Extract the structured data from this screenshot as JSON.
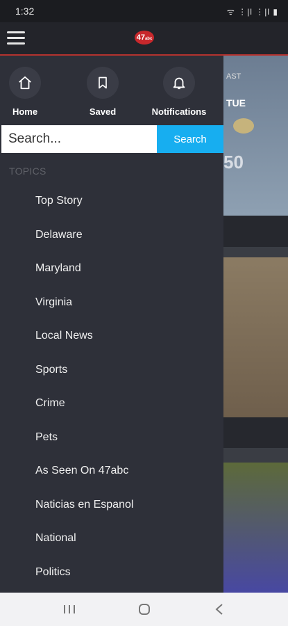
{
  "status_bar": {
    "time": "1:32",
    "icons": "ᯤ ⋮|l ⋮|l ▮"
  },
  "app_bar": {
    "logo_text": "47",
    "logo_sub": "abc"
  },
  "drawer": {
    "quick_actions": [
      {
        "label": "Home",
        "icon": "home-icon"
      },
      {
        "label": "Saved",
        "icon": "bookmark-icon"
      },
      {
        "label": "Notifications",
        "icon": "bell-icon"
      }
    ],
    "search": {
      "placeholder": "Search...",
      "button_label": "Search"
    },
    "topics_heading": "TOPICS",
    "topics": [
      "Top Story",
      "Delaware",
      "Maryland",
      "Virginia",
      "Local News",
      "Sports",
      "Crime",
      "Pets",
      "As Seen On 47abc",
      "Naticias en Espanol",
      "National",
      "Politics"
    ]
  },
  "background": {
    "label1": "AST",
    "label2": "TUE",
    "temp": "50"
  },
  "colors": {
    "accent": "#17aef0",
    "brand": "#c8282c",
    "drawer_bg": "#2e3039"
  }
}
